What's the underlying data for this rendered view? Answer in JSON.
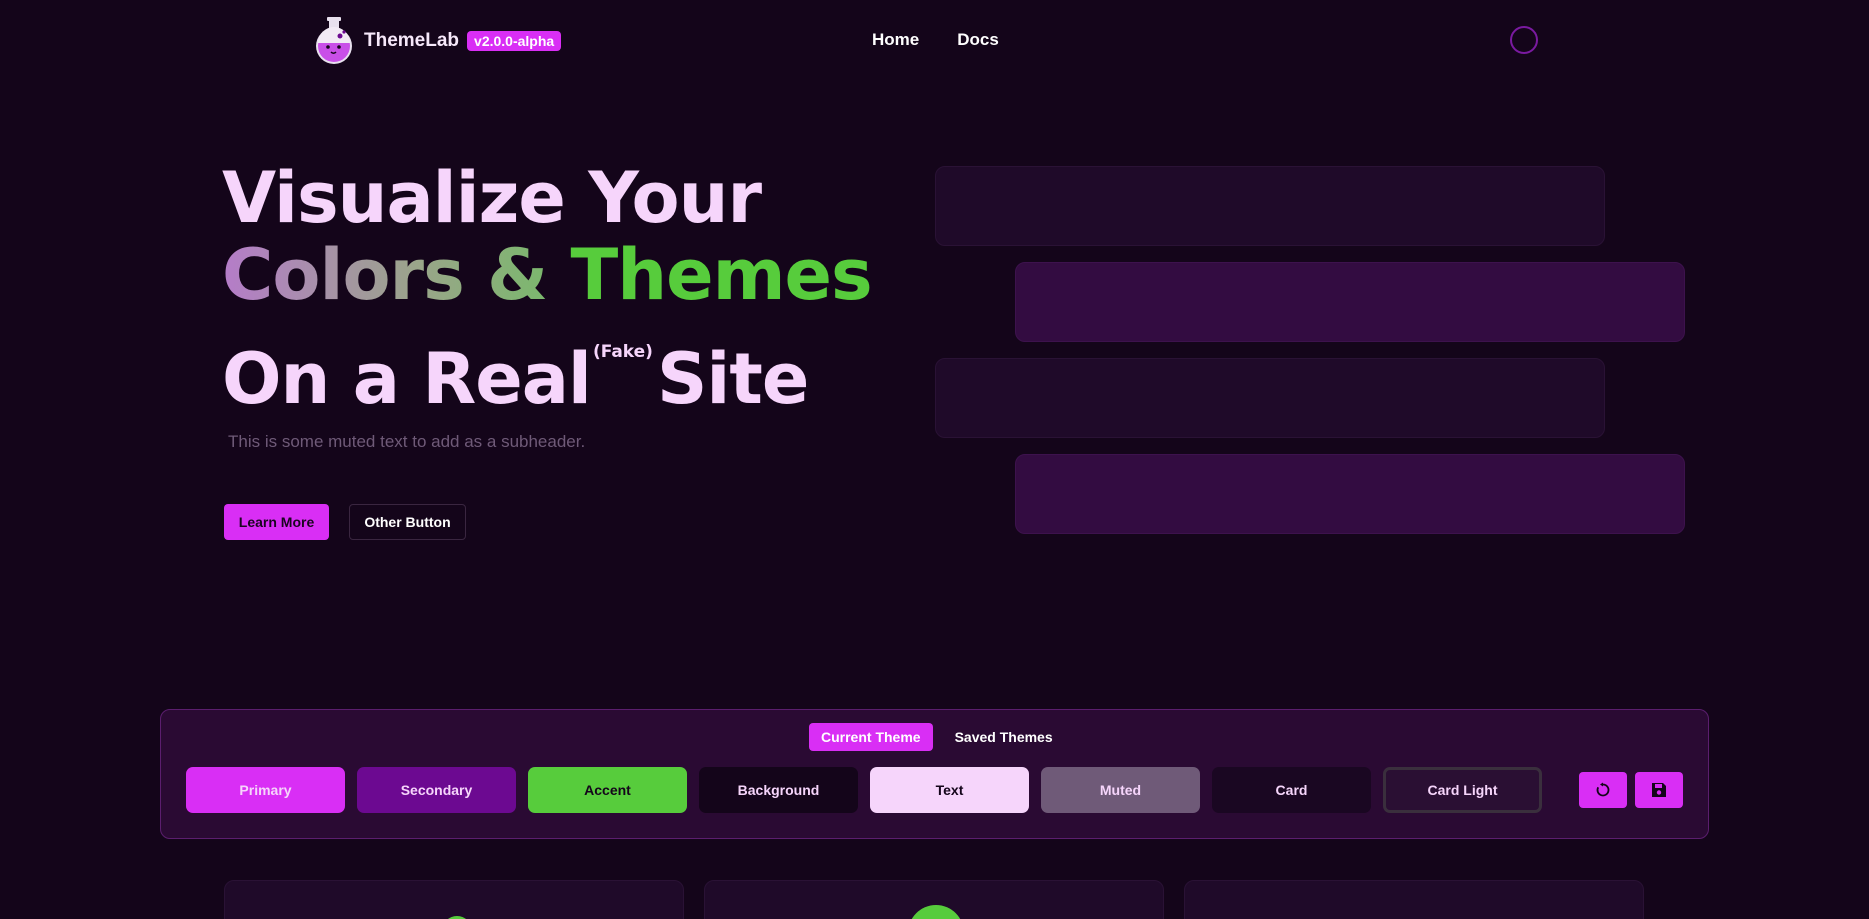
{
  "nav": {
    "brand": "ThemeLab",
    "version": "v2.0.0-alpha",
    "links": [
      "Home",
      "Docs"
    ]
  },
  "hero": {
    "line1": "Visualize Your",
    "line2_part1": "Colors &",
    "line2_part2": "Themes",
    "line3_part1": "On a Real",
    "line3_sup": "(Fake)",
    "line3_part2": "Site",
    "subheader": "This is some muted text to add as a subheader.",
    "primary_button": "Learn More",
    "secondary_button": "Other Button"
  },
  "theme_panel": {
    "tabs": [
      "Current Theme",
      "Saved Themes"
    ],
    "swatches": [
      {
        "label": "Primary",
        "color": "#d92ef5",
        "text": "#f6d5fb"
      },
      {
        "label": "Secondary",
        "color": "#6c0991",
        "text": "#f6d5fb"
      },
      {
        "label": "Accent",
        "color": "#57cc3c",
        "text": "#14051a"
      },
      {
        "label": "Background",
        "color": "#14051a",
        "text": "#f6d5fb"
      },
      {
        "label": "Text",
        "color": "#f6d5fb",
        "text": "#14051a"
      },
      {
        "label": "Muted",
        "color": "#6f5a78",
        "text": "#f6d5fb"
      },
      {
        "label": "Card",
        "color": "#1a0722",
        "text": "#f6d5fb"
      },
      {
        "label": "Card Light",
        "color": "#2a0f33",
        "text": "#f6d5fb"
      }
    ],
    "icons": [
      "refresh-icon",
      "save-icon"
    ]
  },
  "colors": {
    "primary": "#d92ef5",
    "accent": "#57cc3c",
    "background": "#14051a"
  }
}
